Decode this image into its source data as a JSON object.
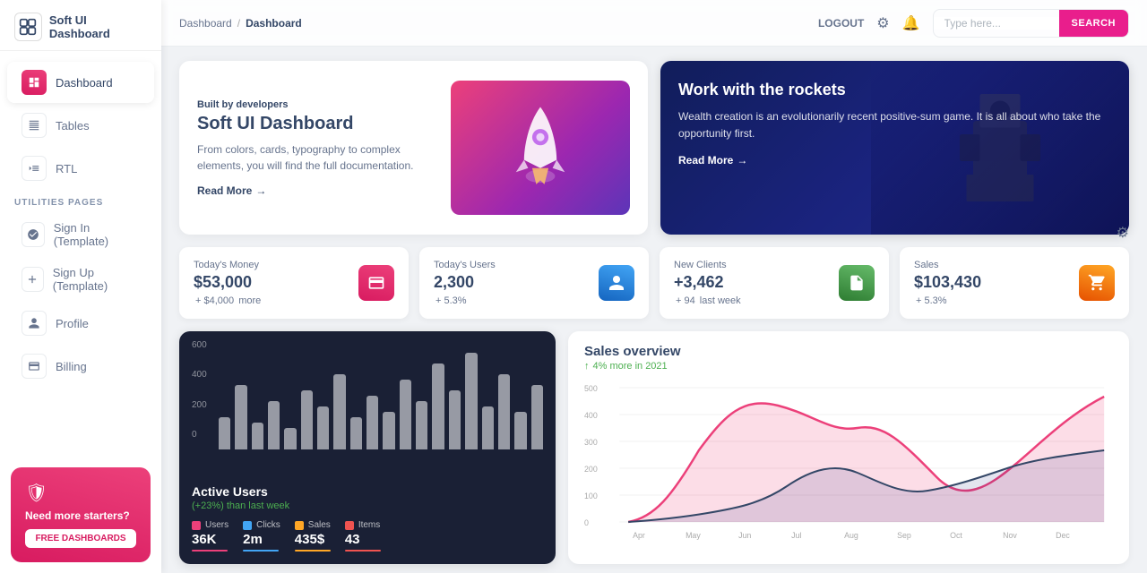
{
  "brand": {
    "title": "Soft UI Dashboard"
  },
  "sidebar": {
    "items": [
      {
        "id": "dashboard",
        "label": "Dashboard",
        "icon": "⊞",
        "active": true
      },
      {
        "id": "tables",
        "label": "Tables",
        "icon": "⊟",
        "active": false
      },
      {
        "id": "rtl",
        "label": "RTL",
        "icon": "✦",
        "active": false
      }
    ],
    "utilities_label": "UTILITIES PAGES",
    "utility_items": [
      {
        "id": "signin",
        "label": "Sign In (Template)",
        "icon": "◻"
      },
      {
        "id": "signup",
        "label": "Sign Up (Template)",
        "icon": "✦"
      },
      {
        "id": "profile",
        "label": "Profile",
        "icon": "◻"
      },
      {
        "id": "billing",
        "label": "Billing",
        "icon": "◻"
      }
    ],
    "promo": {
      "title": "Need more starters?",
      "button": "FREE DASHBOARDS"
    }
  },
  "header": {
    "breadcrumb_parent": "Dashboard",
    "breadcrumb_current": "Dashboard",
    "logout_label": "LOGOUT",
    "search_placeholder": "Type here...",
    "search_button": "SEARCH"
  },
  "hero": {
    "subtitle": "Built by developers",
    "title": "Soft UI Dashboard",
    "description": "From colors, cards, typography to complex elements, you will find the full documentation.",
    "read_more": "Read More"
  },
  "dark_hero": {
    "title": "Work with the rockets",
    "description": "Wealth creation is an evolutionarily recent positive-sum game. It is all about who take the opportunity first.",
    "read_more": "Read More"
  },
  "stats": [
    {
      "label": "Today's Money",
      "value": "$53,000",
      "change": "+ $4,000",
      "change_suffix": "more",
      "icon": "💳",
      "icon_class": "pink"
    },
    {
      "label": "Today's Users",
      "value": "2,300",
      "change": "+ 5.3%",
      "change_suffix": "",
      "icon": "👤",
      "icon_class": "blue"
    },
    {
      "label": "New Clients",
      "value": "+3,462",
      "change": "+ 94",
      "change_suffix": "last week",
      "icon": "📄",
      "icon_class": "green"
    },
    {
      "label": "Sales",
      "value": "$103,430",
      "change": "+ 5.3%",
      "change_suffix": "",
      "icon": "🛒",
      "icon_class": "orange"
    }
  ],
  "bar_chart": {
    "y_labels": [
      "600",
      "400",
      "200",
      "0"
    ],
    "bars": [
      30,
      60,
      25,
      45,
      20,
      55,
      40,
      70,
      30,
      50,
      35,
      65,
      45,
      80,
      55,
      90,
      40,
      70,
      35,
      60
    ],
    "active_users": "Active Users",
    "active_sub": "(+23%) than last week",
    "legend": [
      {
        "label": "Users",
        "value": "36K",
        "color": "#ec407a"
      },
      {
        "label": "Clicks",
        "value": "2m",
        "color": "#42a5f5"
      },
      {
        "label": "Sales",
        "value": "435$",
        "color": "#ffa726"
      },
      {
        "label": "Items",
        "value": "43",
        "color": "#ef5350"
      }
    ]
  },
  "line_chart": {
    "title": "Sales overview",
    "subtitle": "4% more in 2021",
    "y_labels": [
      "500",
      "400",
      "300",
      "200",
      "100",
      "0"
    ],
    "x_labels": [
      "Apr",
      "May",
      "Jun",
      "Jul",
      "Aug",
      "Sep",
      "Oct",
      "Nov",
      "Dec"
    ]
  }
}
